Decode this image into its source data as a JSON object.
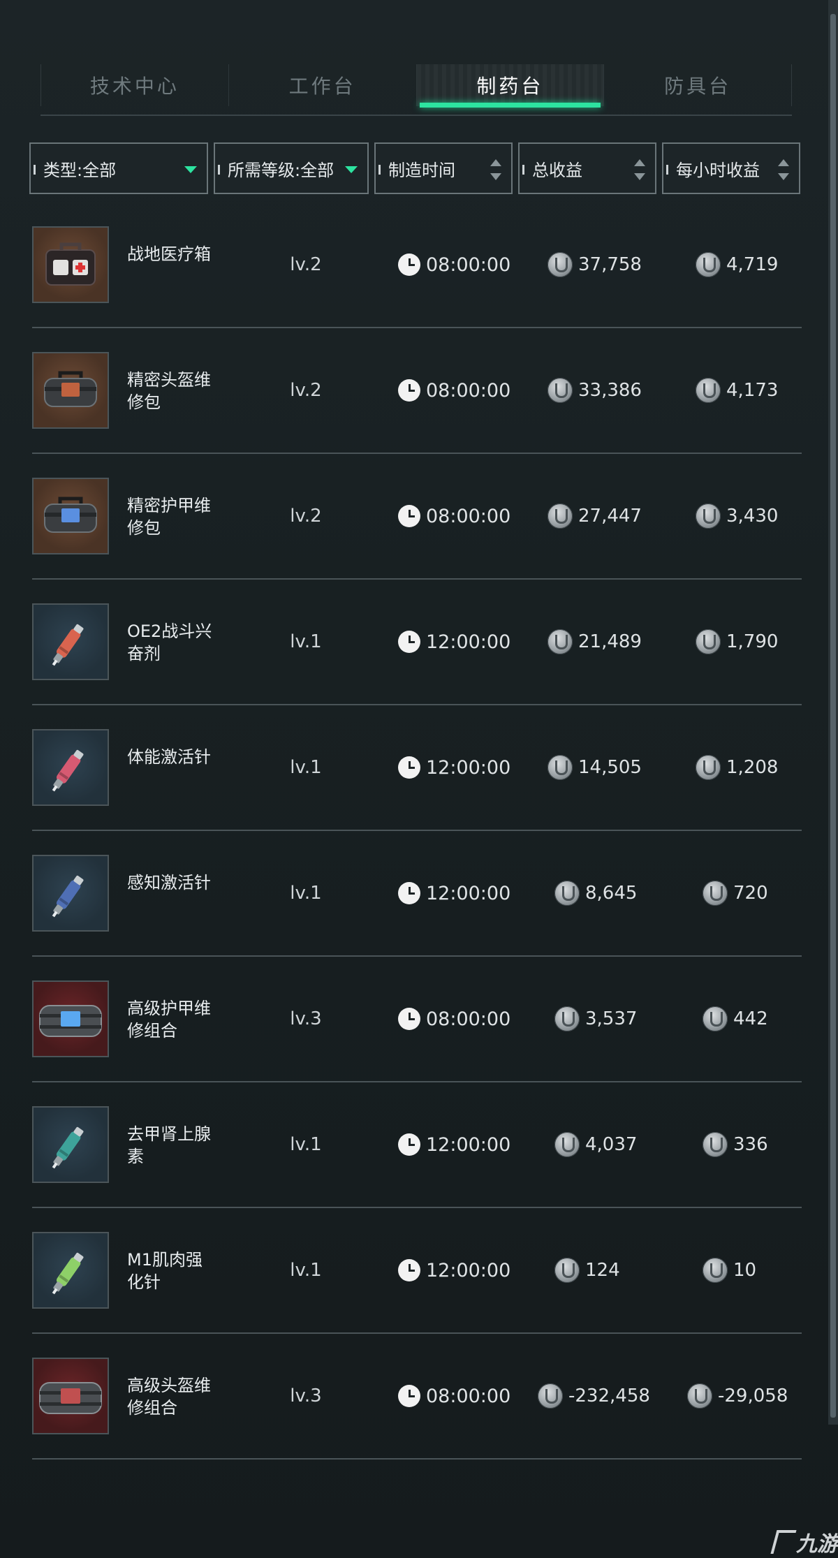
{
  "tabs": [
    {
      "label": "技术中心",
      "active": false
    },
    {
      "label": "工作台",
      "active": false
    },
    {
      "label": "制药台",
      "active": true
    },
    {
      "label": "防具台",
      "active": false
    }
  ],
  "filters": {
    "type": "类型:全部",
    "level": "所需等级:全部",
    "craft_time": "制造时间",
    "total_profit": "总收益",
    "hourly_profit": "每小时收益"
  },
  "colors": {
    "accent": "#2de3a0",
    "background": "#161d1f",
    "divider": "#4a5458"
  },
  "items": [
    {
      "name": "战地医疗箱",
      "icon": "medical-kit-icon",
      "bg": "brown",
      "level": "lv.2",
      "time": "08:00:00",
      "total": "37,758",
      "hourly": "4,719"
    },
    {
      "name": "精密头盔维修包",
      "icon": "repair-bag-icon",
      "bg": "brown",
      "level": "lv.2",
      "time": "08:00:00",
      "total": "33,386",
      "hourly": "4,173"
    },
    {
      "name": "精密护甲维修包",
      "icon": "repair-bag-icon",
      "bg": "brown",
      "level": "lv.2",
      "time": "08:00:00",
      "total": "27,447",
      "hourly": "3,430"
    },
    {
      "name": "OE2战斗兴奋剂",
      "icon": "injector-icon",
      "bg": "blue",
      "level": "lv.1",
      "time": "12:00:00",
      "total": "21,489",
      "hourly": "1,790"
    },
    {
      "name": "体能激活针",
      "icon": "injector-icon",
      "bg": "blue",
      "level": "lv.1",
      "time": "12:00:00",
      "total": "14,505",
      "hourly": "1,208"
    },
    {
      "name": "感知激活针",
      "icon": "injector-icon",
      "bg": "blue",
      "level": "lv.1",
      "time": "12:00:00",
      "total": "8,645",
      "hourly": "720"
    },
    {
      "name": "高级护甲维修组合",
      "icon": "repair-kit-icon",
      "bg": "red",
      "level": "lv.3",
      "time": "08:00:00",
      "total": "3,537",
      "hourly": "442"
    },
    {
      "name": "去甲肾上腺素",
      "icon": "injector-icon",
      "bg": "blue",
      "level": "lv.1",
      "time": "12:00:00",
      "total": "4,037",
      "hourly": "336"
    },
    {
      "name": "M1肌肉强化针",
      "icon": "injector-icon",
      "bg": "blue",
      "level": "lv.1",
      "time": "12:00:00",
      "total": "124",
      "hourly": "10"
    },
    {
      "name": "高级头盔维修组合",
      "icon": "repair-kit-icon",
      "bg": "red",
      "level": "lv.3",
      "time": "08:00:00",
      "total": "-232,458",
      "hourly": "-29,058"
    }
  ],
  "watermark": "九游"
}
